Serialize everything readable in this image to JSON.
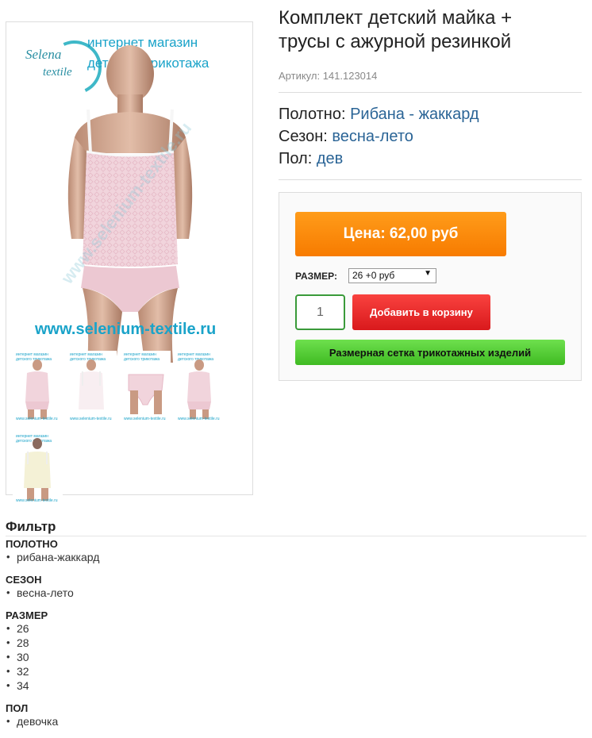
{
  "product": {
    "title": "Комплект детский майка + трусы с ажурной резинкой",
    "sku": "Артикул: 141.123014",
    "properties": [
      {
        "label": "Полотно: ",
        "value": "Рибана - жаккард"
      },
      {
        "label": "Сезон: ",
        "value": "весна-лето"
      },
      {
        "label": "Пол: ",
        "value": "дев"
      }
    ]
  },
  "image": {
    "brand_line1": "Selena",
    "brand_line2": "textile",
    "shop_title_1": "интернет магазин",
    "shop_title_2": "детского трикотажа",
    "shop_url": "www.selenium-textile.ru",
    "watermark": "www.selenium-textile.ru",
    "thumb_caption": "интернет магазин детского трикотажа",
    "thumb_url": "www.selenium-textile.ru",
    "thumbs": [
      "set-pink",
      "top-white",
      "briefs-pink",
      "set-pink-2",
      "set-cream"
    ]
  },
  "buy": {
    "price_label": "Цена: 62,00 руб",
    "size_label": "РАЗМЕР:",
    "size_selected": "26 +0 руб",
    "quantity": "1",
    "add_to_cart": "Добавить в корзину",
    "size_chart": "Размерная сетка трикотажных изделий"
  },
  "filter": {
    "title": "Фильтр",
    "groups": [
      {
        "name": "ПОЛОТНО",
        "items": [
          "рибана-жаккард"
        ]
      },
      {
        "name": "СЕЗОН",
        "items": [
          "весна-лето"
        ]
      },
      {
        "name": "РАЗМЕР",
        "items": [
          "26",
          "28",
          "30",
          "32",
          "34"
        ]
      },
      {
        "name": "ПОЛ",
        "items": [
          "девочка"
        ]
      }
    ]
  },
  "colors": {
    "price_button": "#f88a0c",
    "cart_button": "#e52a2a",
    "size_chart_button": "#52cc34",
    "accent_link": "#2a6496",
    "brand_teal": "#1aa3c9"
  }
}
